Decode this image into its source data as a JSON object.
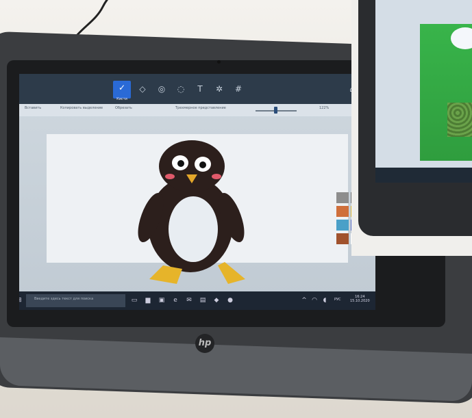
{
  "paint_app": {
    "brush_label": "Кисти",
    "toolbar_items": [
      "Вставить",
      "Копировать выделение",
      "Обрезать",
      "Трехмерное представление"
    ],
    "zoom_percent": "122%"
  },
  "taskbar": {
    "search_placeholder": "Введите здесь текст для поиска",
    "language": "РУС",
    "time": "16:24",
    "date": "15.10.2020"
  },
  "brand_logo": "hp",
  "palette_colors": [
    "#8d8d8d",
    "#6e6e6e",
    "#7f7f7f",
    "#b26b6b",
    "#c43d3d",
    "#cf6f3b",
    "#d8b43a",
    "#cfcf42",
    "#a4c440",
    "#6bb84d",
    "#4aa0c8",
    "#5a6fc8",
    "#8c5ac6",
    "#c45ab0",
    "#9fb2c8",
    "#a0522d",
    "#ffffff",
    "#d2a050",
    "#ffffff",
    "#b05ac0"
  ]
}
